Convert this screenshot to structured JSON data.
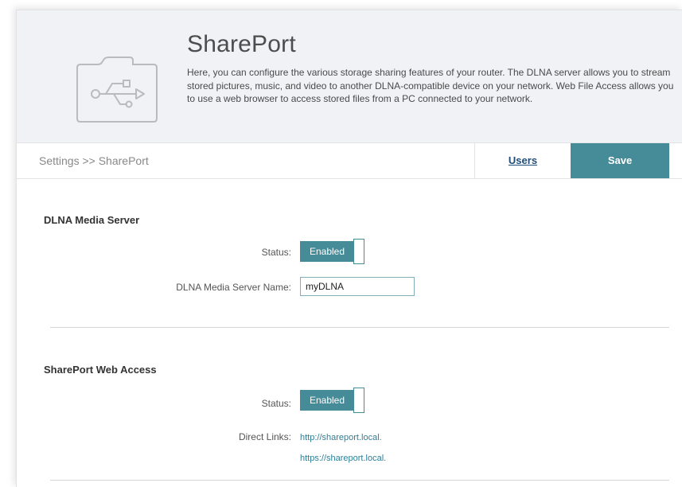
{
  "header": {
    "title": "SharePort",
    "description": "Here, you can configure the various storage sharing features of your router. The DLNA server allows you to stream stored pictures, music, and video to another DLNA-compatible device on your network. Web File Access allows you to use a web browser to access stored files from a PC connected to your network.",
    "icon": "usb-icon"
  },
  "breadcrumb": "Settings >> SharePort",
  "actions": {
    "users_label": "Users",
    "save_label": "Save"
  },
  "dlna": {
    "section_title": "DLNA Media Server",
    "status_label": "Status:",
    "status_value": "Enabled",
    "name_label": "DLNA Media Server Name:",
    "name_value": "myDLNA"
  },
  "web_access": {
    "section_title": "SharePort Web Access",
    "status_label": "Status:",
    "status_value": "Enabled",
    "links_label": "Direct Links:",
    "links": [
      "http://shareport.local.",
      "https://shareport.local."
    ]
  },
  "colors": {
    "accent": "#468b98",
    "link": "#2f7f95",
    "users_link": "#1f4d7a"
  }
}
